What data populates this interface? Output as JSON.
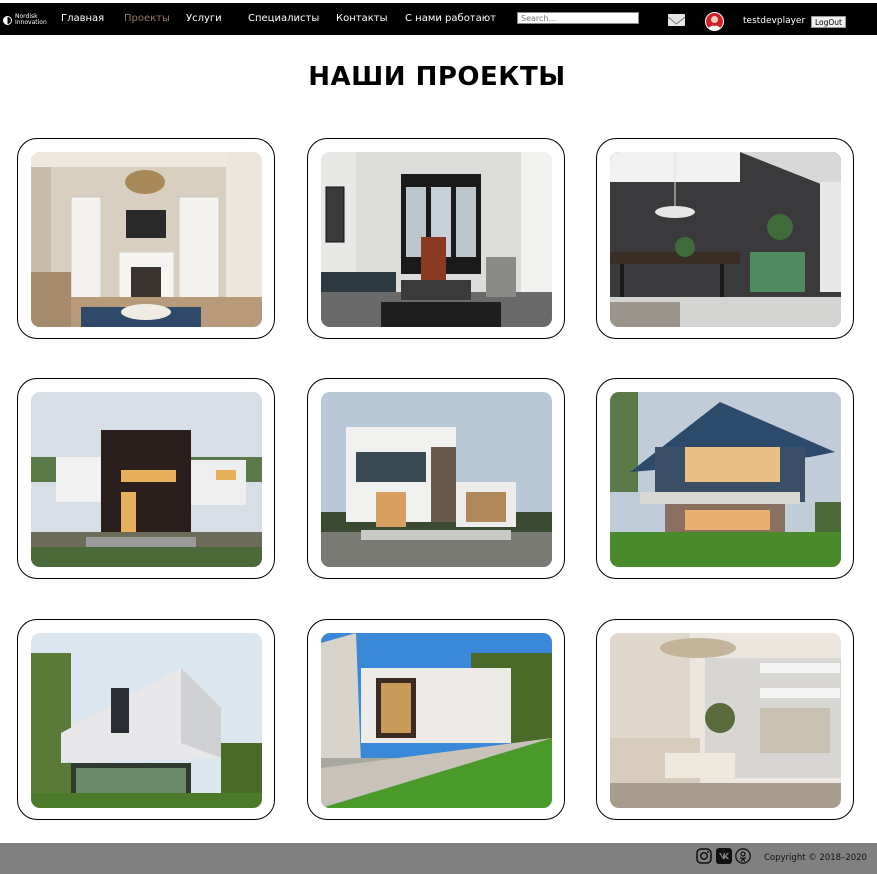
{
  "logo": {
    "brand_line1": "Nordisk",
    "brand_line2": "Innovation"
  },
  "nav": {
    "items": [
      {
        "label": "Главная",
        "active": false
      },
      {
        "label": "Проекты",
        "active": true
      },
      {
        "label": "Услуги",
        "active": false
      },
      {
        "label": "Специалисты",
        "active": false
      },
      {
        "label": "Контакты",
        "active": false
      },
      {
        "label": "С нами работают",
        "active": false
      }
    ],
    "search_placeholder": "Search...",
    "mail_icon": "envelope-icon",
    "avatar_icon": "user-avatar-icon",
    "username": "testdevplayer",
    "logout_label": "LogOut"
  },
  "page_title": "НАШИ ПРОЕКТЫ",
  "projects": [
    {
      "image": "living-room-fireplace-chandelier"
    },
    {
      "image": "living-room-bay-window-sofa"
    },
    {
      "image": "dark-kitchen-dining-pendant"
    },
    {
      "image": "modern-house-dark-facade"
    },
    {
      "image": "modern-house-dusk-white"
    },
    {
      "image": "modern-house-blue-roof-lawn"
    },
    {
      "image": "white-cube-house-glass"
    },
    {
      "image": "flat-roof-house-lawn"
    },
    {
      "image": "bright-living-room-chandelier"
    }
  ],
  "footer": {
    "social_icons": [
      "instagram-icon",
      "vk-icon",
      "odnoklassniki-icon"
    ],
    "copyright": "Copyright © 2018–2020"
  },
  "colors": {
    "navbar": "#000000",
    "active_nav": "#9a7a66",
    "footer": "#808080"
  }
}
